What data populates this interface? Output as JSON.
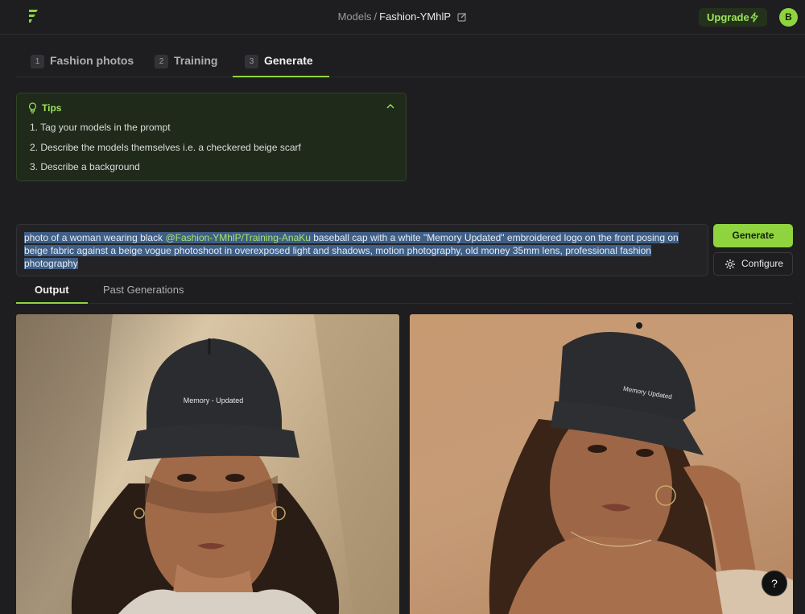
{
  "header": {
    "breadcrumb_root": "Models",
    "breadcrumb_sep": "/",
    "breadcrumb_current": "Fashion-YMhlP",
    "upgrade_label": "Upgrade",
    "avatar_initial": "B"
  },
  "steps": [
    {
      "num": "1",
      "label": "Fashion photos"
    },
    {
      "num": "2",
      "label": "Training"
    },
    {
      "num": "3",
      "label": "Generate"
    }
  ],
  "tips": {
    "title": "Tips",
    "items": [
      "1. Tag your models in the prompt",
      "2. Describe the models themselves i.e. a checkered beige scarf",
      "3. Describe a background"
    ]
  },
  "prompt": {
    "before_tag": "photo of a woman wearing black ",
    "tag": "@Fashion-YMhlP/Training-AnaKu",
    "after_tag": " baseball cap with a white \"Memory Updated\" embroidered logo on the front posing on beige fabric against a beige vogue photoshoot in overexposed light and shadows, motion photography, old money 35mm lens, professional fashion photography"
  },
  "buttons": {
    "generate": "Generate",
    "configure": "Configure"
  },
  "output_tabs": [
    "Output",
    "Past Generations"
  ],
  "images": {
    "cap_text_1": "Memory - Updated",
    "cap_text_2": "Memory Updated"
  },
  "help_label": "?",
  "colors": {
    "accent": "#8fd43f",
    "background": "#1e1e20",
    "tips_bg": "#1f2a1a",
    "selection": "#3f5f86"
  }
}
